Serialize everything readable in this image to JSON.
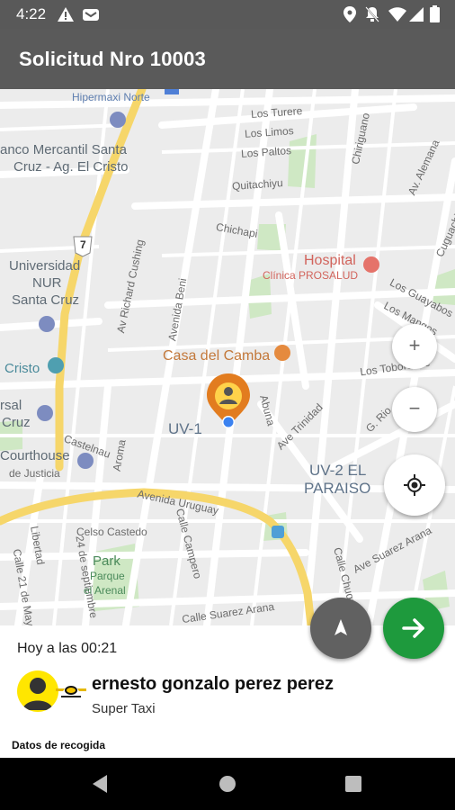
{
  "status_bar": {
    "time": "4:22",
    "icons": [
      "warning-icon",
      "notification-icon",
      "location-icon",
      "mute-icon",
      "wifi-icon",
      "signal-icon",
      "battery-icon"
    ]
  },
  "app_bar": {
    "title": "Solicitud Nro 10003",
    "color": "#5a5a5a"
  },
  "map": {
    "labels": {
      "hipermaxi": "Hipermaxi Norte",
      "banco_1": "anco Mercantil Santa",
      "banco_2": "Cruz - Ag. El Cristo",
      "turere": "Los Turere",
      "limos": "Los Limos",
      "paltos": "Los Paltos",
      "quitachiyu": "Quitachiyu",
      "chiriguano": "Chiriguano",
      "alemana": "Av. Alemana",
      "chichapi": "Chichapi",
      "cuguachich": "Cuguachich",
      "route": "7",
      "universidad_1": "Universidad",
      "universidad_2": "NUR",
      "universidad_3": "Santa Cruz",
      "cushing": "Av Richard Cushing",
      "beni": "Avenida Beni",
      "hospital": "Hospital",
      "clinica": "Clínica PROSALUD",
      "guayabos": "Los Guayabos",
      "mangos": "Los Mangos",
      "tobosoche": "Los Toboroche",
      "cristo": "Cristo",
      "casa_camba": "Casa del Camba",
      "rsal_1": "rsal",
      "rsal_2": "Cruz",
      "uv1": "UV-1",
      "abuna": "Abuna",
      "trinidad": "Ave Trinidad",
      "rio": "G. Rio",
      "courthouse_1": "Courthouse",
      "courthouse_2": "de Justicia",
      "castelnau": "Castelnau",
      "aroma": "Aroma",
      "uv2_1": "UV-2 EL",
      "uv2_2": "PARAISO",
      "uruguay": "Avenida Uruguay",
      "celso": "Celso Castedo",
      "campero": "Calle Campero",
      "libertad": "Libertad",
      "septiembre": "24 de septiembre",
      "calle21": "Calle 21 de Mayo",
      "park_1": "Park",
      "park_2": "Parque",
      "park_3": "el Arenal",
      "suarez_arana": "Calle Suarez Arana",
      "suarez_ave": "Ave Suarez Arana",
      "chuq": "Calle Chuquisaca"
    },
    "zoom_in": "+",
    "zoom_out": "−"
  },
  "trip": {
    "when": "Hoy a las 00:21",
    "driver_name": "ernesto gonzalo perez perez",
    "company": "Super Taxi",
    "section_title": "Datos de recogida"
  },
  "colors": {
    "accent_green": "#1e9a3d",
    "marker_orange": "#e27c1f",
    "nav_dark": "#616161",
    "avatar_yellow": "#ffe600"
  }
}
